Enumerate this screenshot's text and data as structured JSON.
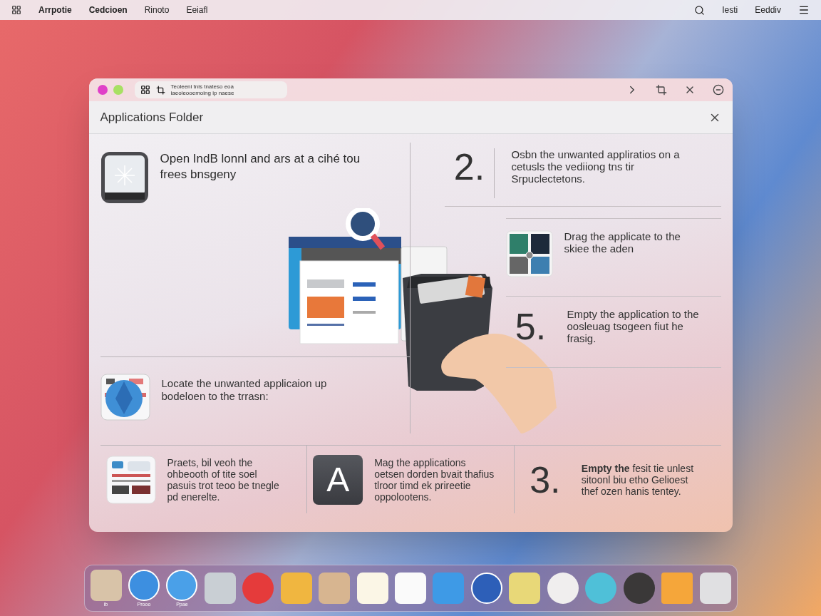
{
  "menu_bar": {
    "left_items": [
      "Arrpotie",
      "Cedcioen",
      "Rinoto",
      "Eeiafl"
    ],
    "right_items": [
      "Iesti",
      "Eeddiv"
    ]
  },
  "window": {
    "address_lines": [
      "Teoleeni tnis tnateso eoa",
      "iaeoieooemoing ip naese"
    ],
    "title": "Applications Folder"
  },
  "top_left_steps": [
    {
      "kind": "icon",
      "text": "Open IndB lonnl and ars at a cihé tou frees bnsgeny"
    },
    {
      "kind": "icon",
      "text": "Locate the unwanted applicaion up bodeloen to the trrasn:"
    }
  ],
  "right_steps": [
    {
      "kind": "number",
      "number": "2.",
      "text": "Osbn the unwanted appliratios on a cetusls the vediiong tns tir Srpuclectetons."
    },
    {
      "kind": "icon",
      "text": "Drag the applicate to the skiee the aden"
    },
    {
      "kind": "number",
      "number": "5.",
      "text": "Empty the application to the oosleuag tsogeen fiut he frasig."
    }
  ],
  "bottom_steps": [
    {
      "kind": "icon",
      "text": "Praets, bil veoh the ohbeooth of tite soel pasuis  trot teoo be tnegle pd enerelte."
    },
    {
      "kind": "letter",
      "number": "A",
      "text": "Mag the applications oetsen dorden bvait thafius tlroor timd ek prireetie oppolootens."
    },
    {
      "kind": "number",
      "number": "3.",
      "text": "**Empty the** fesit tie unlest sitoonl biu etho Gelioest thef ozen hanis tentey."
    }
  ],
  "dock": {
    "labels": [
      "ib",
      "Prooo",
      "Ppae"
    ]
  }
}
